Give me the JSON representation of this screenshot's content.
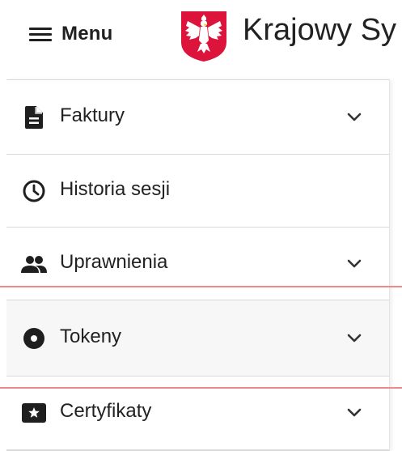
{
  "header": {
    "menu_label": "Menu",
    "app_title": "Krajowy Sy",
    "emblem_icon": "polish-eagle-emblem",
    "emblem_color": "#dc143c"
  },
  "menu": {
    "items": [
      {
        "label": "Faktury",
        "icon": "document-icon",
        "has_chevron": true
      },
      {
        "label": "Historia sesji",
        "icon": "clock-icon",
        "has_chevron": false
      },
      {
        "label": "Uprawnienia",
        "icon": "people-icon",
        "has_chevron": true
      },
      {
        "label": "Tokeny",
        "icon": "disc-icon",
        "has_chevron": true,
        "active": true
      },
      {
        "label": "Certyfikaty",
        "icon": "certificate-icon",
        "has_chevron": true
      }
    ]
  },
  "colors": {
    "text": "#222222",
    "divider": "#d9d9d9",
    "highlight": "#f08a8a"
  }
}
